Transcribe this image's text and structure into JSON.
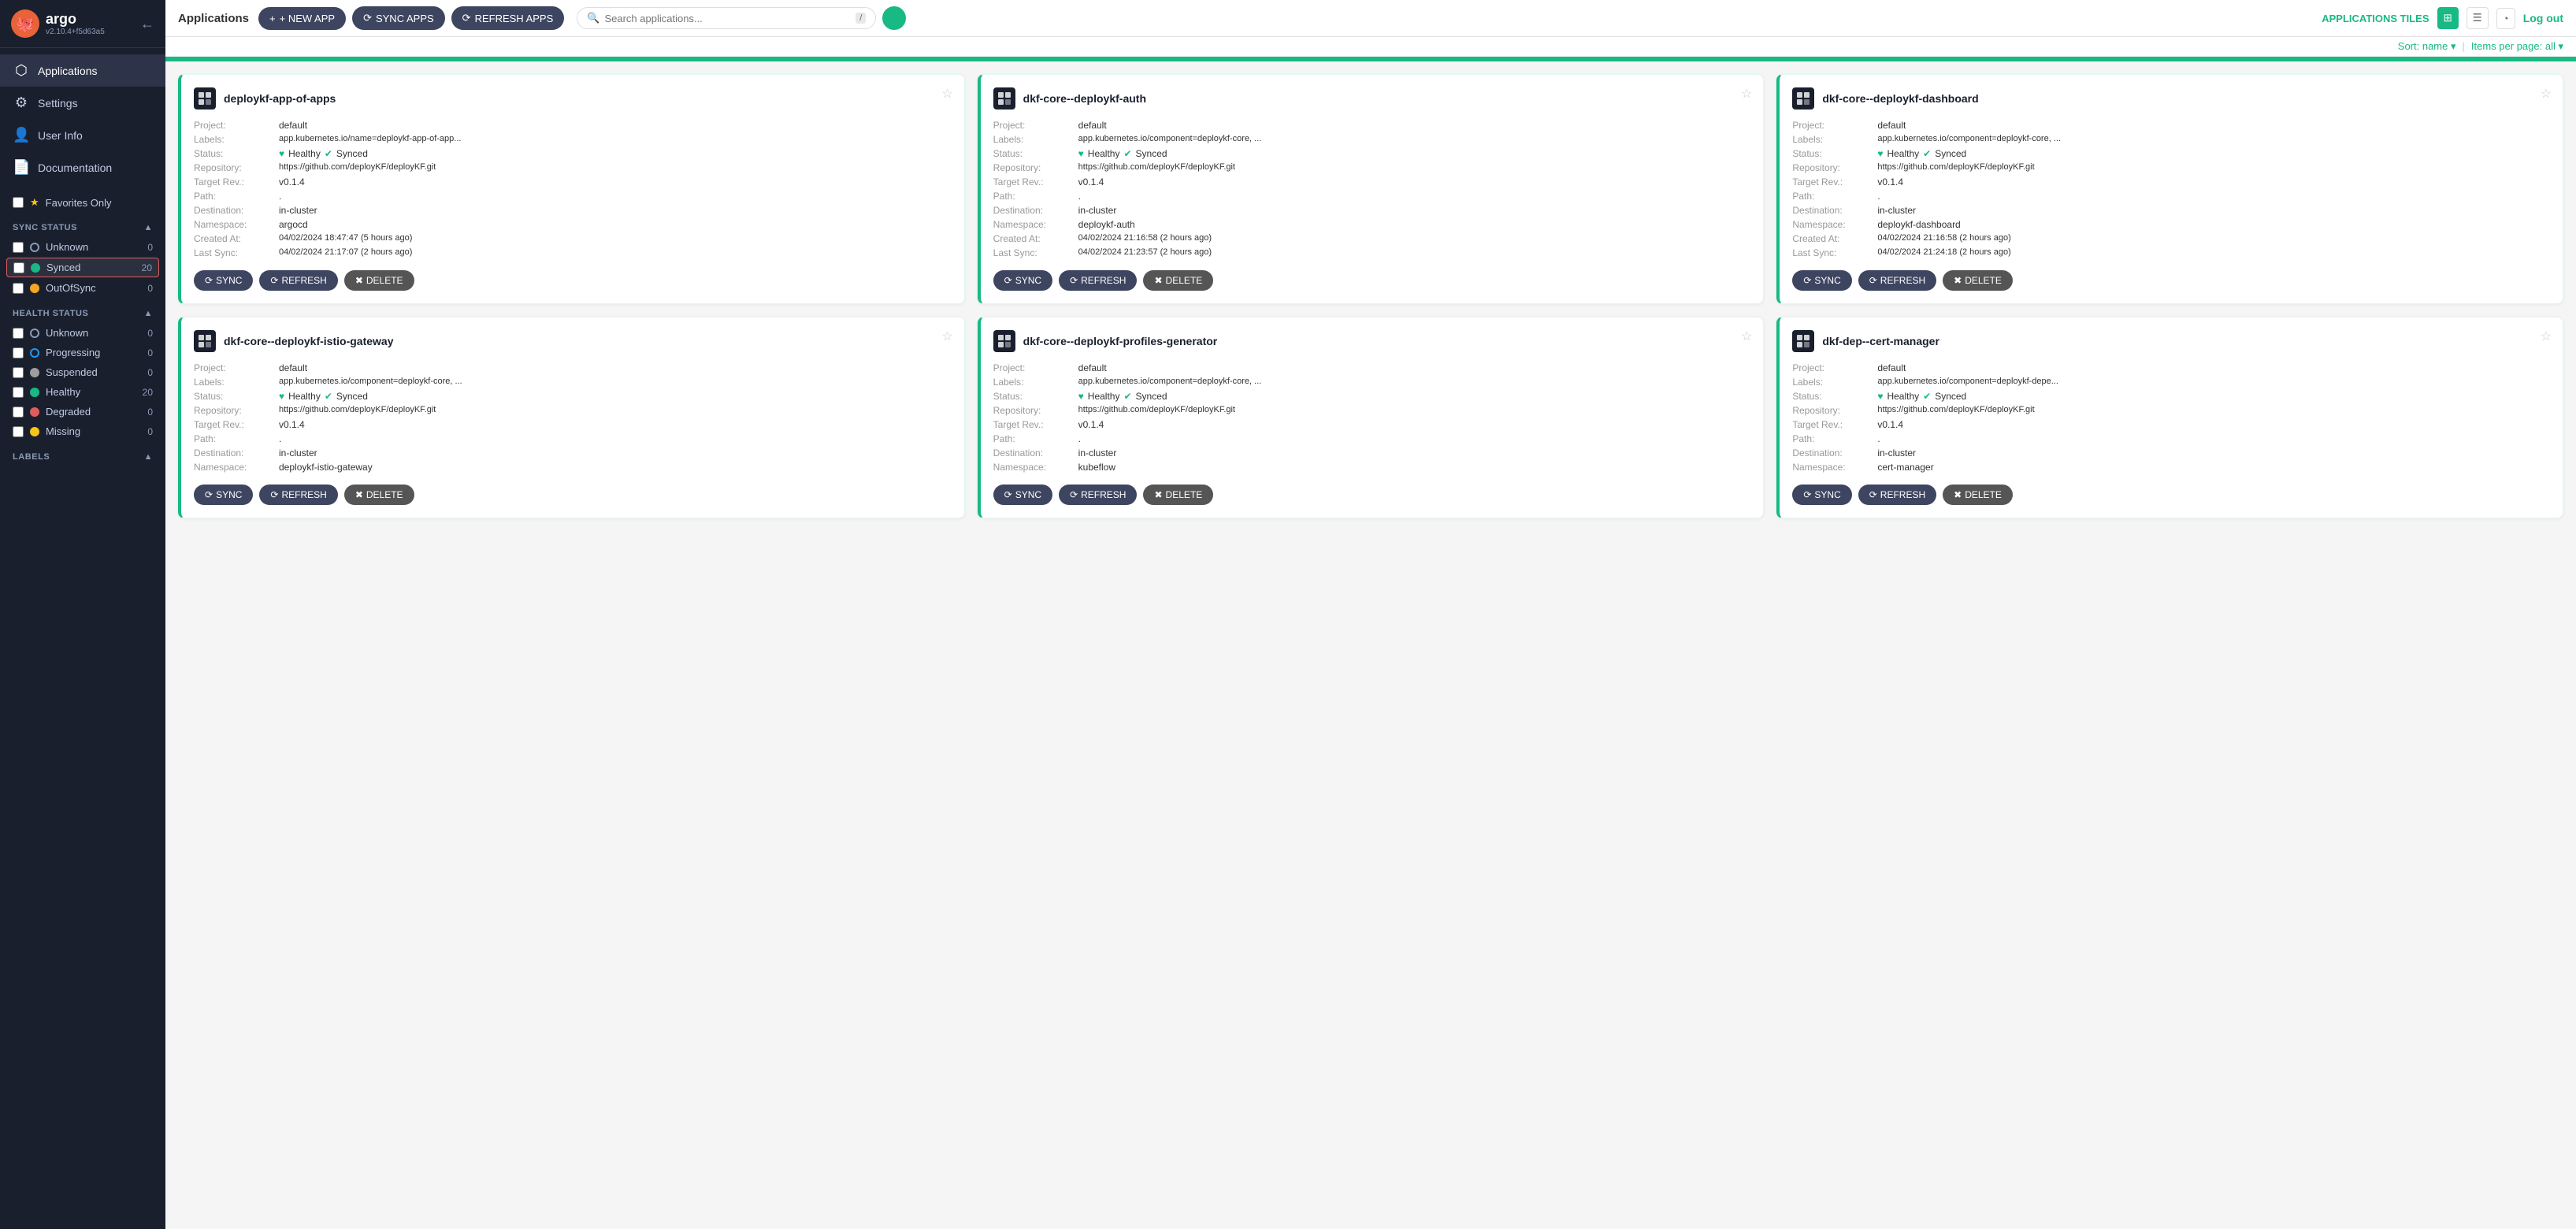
{
  "sidebar": {
    "logo": {
      "name": "argo",
      "version": "v2.10.4+f5d63a5",
      "icon": "🐙"
    },
    "nav_items": [
      {
        "id": "applications",
        "label": "Applications",
        "active": true
      },
      {
        "id": "settings",
        "label": "Settings",
        "active": false
      },
      {
        "id": "user-info",
        "label": "User Info",
        "active": false
      },
      {
        "id": "documentation",
        "label": "Documentation",
        "active": false
      }
    ],
    "favorites_label": "Favorites Only",
    "sync_status": {
      "header": "SYNC STATUS",
      "items": [
        {
          "id": "unknown",
          "label": "Unknown",
          "count": 0,
          "dot": "unknown",
          "highlighted": false
        },
        {
          "id": "synced",
          "label": "Synced",
          "count": 20,
          "dot": "synced",
          "highlighted": true
        },
        {
          "id": "outofsync",
          "label": "OutOfSync",
          "count": 0,
          "dot": "outofsync",
          "highlighted": false
        }
      ]
    },
    "health_status": {
      "header": "HEALTH STATUS",
      "items": [
        {
          "id": "unknown",
          "label": "Unknown",
          "count": 0,
          "dot": "health-unknown"
        },
        {
          "id": "progressing",
          "label": "Progressing",
          "count": 0,
          "dot": "progressing"
        },
        {
          "id": "suspended",
          "label": "Suspended",
          "count": 0,
          "dot": "suspended"
        },
        {
          "id": "healthy",
          "label": "Healthy",
          "count": 20,
          "dot": "healthy"
        },
        {
          "id": "degraded",
          "label": "Degraded",
          "count": 0,
          "dot": "degraded"
        },
        {
          "id": "missing",
          "label": "Missing",
          "count": 0,
          "dot": "missing"
        }
      ]
    },
    "labels_header": "LABELS"
  },
  "topbar": {
    "page_title": "Applications",
    "buttons": {
      "new_app": "+ NEW APP",
      "sync_apps": "⟳ SYNC APPS",
      "refresh_apps": "⟳ REFRESH APPS"
    },
    "search_placeholder": "Search applications...",
    "sort_label": "Sort: name",
    "items_per_page": "Items per page: all",
    "app_tiles_label": "APPLICATIONS TILES",
    "logout_label": "Log out"
  },
  "apps": [
    {
      "id": "deploykf-app-of-apps",
      "title": "deploykf-app-of-apps",
      "project": "default",
      "labels": "app.kubernetes.io/name=deploykf-app-of-app...",
      "health": "Healthy",
      "sync": "Synced",
      "repository": "https://github.com/deployKF/deployKF.git",
      "target_rev": "v0.1.4",
      "path": ".",
      "destination": "in-cluster",
      "namespace": "argocd",
      "created_at": "04/02/2024 18:47:47  (5 hours ago)",
      "last_sync": "04/02/2024 21:17:07  (2 hours ago)"
    },
    {
      "id": "dkf-core--deploykf-auth",
      "title": "dkf-core--deploykf-auth",
      "project": "default",
      "labels": "app.kubernetes.io/component=deploykf-core, ...",
      "health": "Healthy",
      "sync": "Synced",
      "repository": "https://github.com/deployKF/deployKF.git",
      "target_rev": "v0.1.4",
      "path": ".",
      "destination": "in-cluster",
      "namespace": "deploykf-auth",
      "created_at": "04/02/2024 21:16:58  (2 hours ago)",
      "last_sync": "04/02/2024 21:23:57  (2 hours ago)"
    },
    {
      "id": "dkf-core--deploykf-dashboard",
      "title": "dkf-core--deploykf-dashboard",
      "project": "default",
      "labels": "app.kubernetes.io/component=deploykf-core, ...",
      "health": "Healthy",
      "sync": "Synced",
      "repository": "https://github.com/deployKF/deployKF.git",
      "target_rev": "v0.1.4",
      "path": ".",
      "destination": "in-cluster",
      "namespace": "deploykf-dashboard",
      "created_at": "04/02/2024 21:16:58  (2 hours ago)",
      "last_sync": "04/02/2024 21:24:18  (2 hours ago)"
    },
    {
      "id": "dkf-core--deploykf-istio-gateway",
      "title": "dkf-core--deploykf-istio-gateway",
      "project": "default",
      "labels": "app.kubernetes.io/component=deploykf-core, ...",
      "health": "Healthy",
      "sync": "Synced",
      "repository": "https://github.com/deployKF/deployKF.git",
      "target_rev": "v0.1.4",
      "path": ".",
      "destination": "in-cluster",
      "namespace": "deploykf-istio-gateway",
      "created_at": "",
      "last_sync": ""
    },
    {
      "id": "dkf-core--deploykf-profiles-generator",
      "title": "dkf-core--deploykf-profiles-generator",
      "project": "default",
      "labels": "app.kubernetes.io/component=deploykf-core, ...",
      "health": "Healthy",
      "sync": "Synced",
      "repository": "https://github.com/deployKF/deployKF.git",
      "target_rev": "v0.1.4",
      "path": ".",
      "destination": "in-cluster",
      "namespace": "kubeflow",
      "created_at": "",
      "last_sync": ""
    },
    {
      "id": "dkf-dep--cert-manager",
      "title": "dkf-dep--cert-manager",
      "project": "default",
      "labels": "app.kubernetes.io/component=deploykf-depe...",
      "health": "Healthy",
      "sync": "Synced",
      "repository": "https://github.com/deployKF/deployKF.git",
      "target_rev": "v0.1.4",
      "path": ".",
      "destination": "in-cluster",
      "namespace": "cert-manager",
      "created_at": "",
      "last_sync": ""
    }
  ],
  "card_labels": {
    "project": "Project:",
    "labels": "Labels:",
    "status": "Status:",
    "repository": "Repository:",
    "target_rev": "Target Rev.:",
    "path": "Path:",
    "destination": "Destination:",
    "namespace": "Namespace:",
    "created_at": "Created At:",
    "last_sync": "Last Sync:"
  },
  "card_buttons": {
    "sync": "SYNC",
    "refresh": "REFRESH",
    "delete": "DELETE"
  }
}
